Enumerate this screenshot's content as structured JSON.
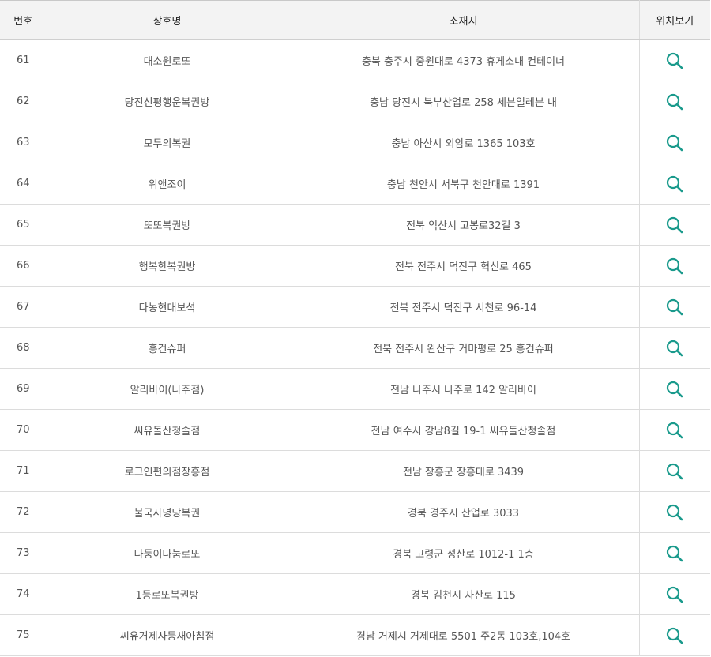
{
  "table": {
    "headers": {
      "num": "번호",
      "name": "상호명",
      "address": "소재지",
      "map": "위치보기"
    },
    "map_icon": "search-icon",
    "accent_color": "#1a9a8c",
    "rows": [
      {
        "num": "61",
        "name": "대소원로또",
        "address": "충북 충주시 중원대로 4373 휴게소내 컨테이너"
      },
      {
        "num": "62",
        "name": "당진신평행운복권방",
        "address": "충남 당진시 북부산업로 258 세븐일레븐 내"
      },
      {
        "num": "63",
        "name": "모두의복권",
        "address": "충남 아산시 외암로 1365 103호"
      },
      {
        "num": "64",
        "name": "위앤조이",
        "address": "충남 천안시 서북구 천안대로 1391"
      },
      {
        "num": "65",
        "name": "또또복권방",
        "address": "전북 익산시 고봉로32길 3"
      },
      {
        "num": "66",
        "name": "행복한복권방",
        "address": "전북 전주시 덕진구 혁신로 465"
      },
      {
        "num": "67",
        "name": "다농현대보석",
        "address": "전북 전주시 덕진구 시천로 96-14"
      },
      {
        "num": "68",
        "name": "흥건슈퍼",
        "address": "전북 전주시 완산구 거마평로 25 흥건슈퍼"
      },
      {
        "num": "69",
        "name": "알리바이(나주점)",
        "address": "전남 나주시 나주로 142 알리바이"
      },
      {
        "num": "70",
        "name": "씨유돌산청솔점",
        "address": "전남 여수시 강남8길 19-1 씨유돌산청솔점"
      },
      {
        "num": "71",
        "name": "로그인편의점장흥점",
        "address": "전남 장흥군 장흥대로 3439"
      },
      {
        "num": "72",
        "name": "불국사명당복권",
        "address": "경북 경주시 산업로 3033"
      },
      {
        "num": "73",
        "name": "다둥이나눔로또",
        "address": "경북 고령군 성산로 1012-1 1층"
      },
      {
        "num": "74",
        "name": "1등로또복권방",
        "address": "경북 김천시 자산로 115"
      },
      {
        "num": "75",
        "name": "씨유거제사등새아침점",
        "address": "경남 거제시 거제대로 5501 주2동 103호,104호"
      }
    ]
  }
}
